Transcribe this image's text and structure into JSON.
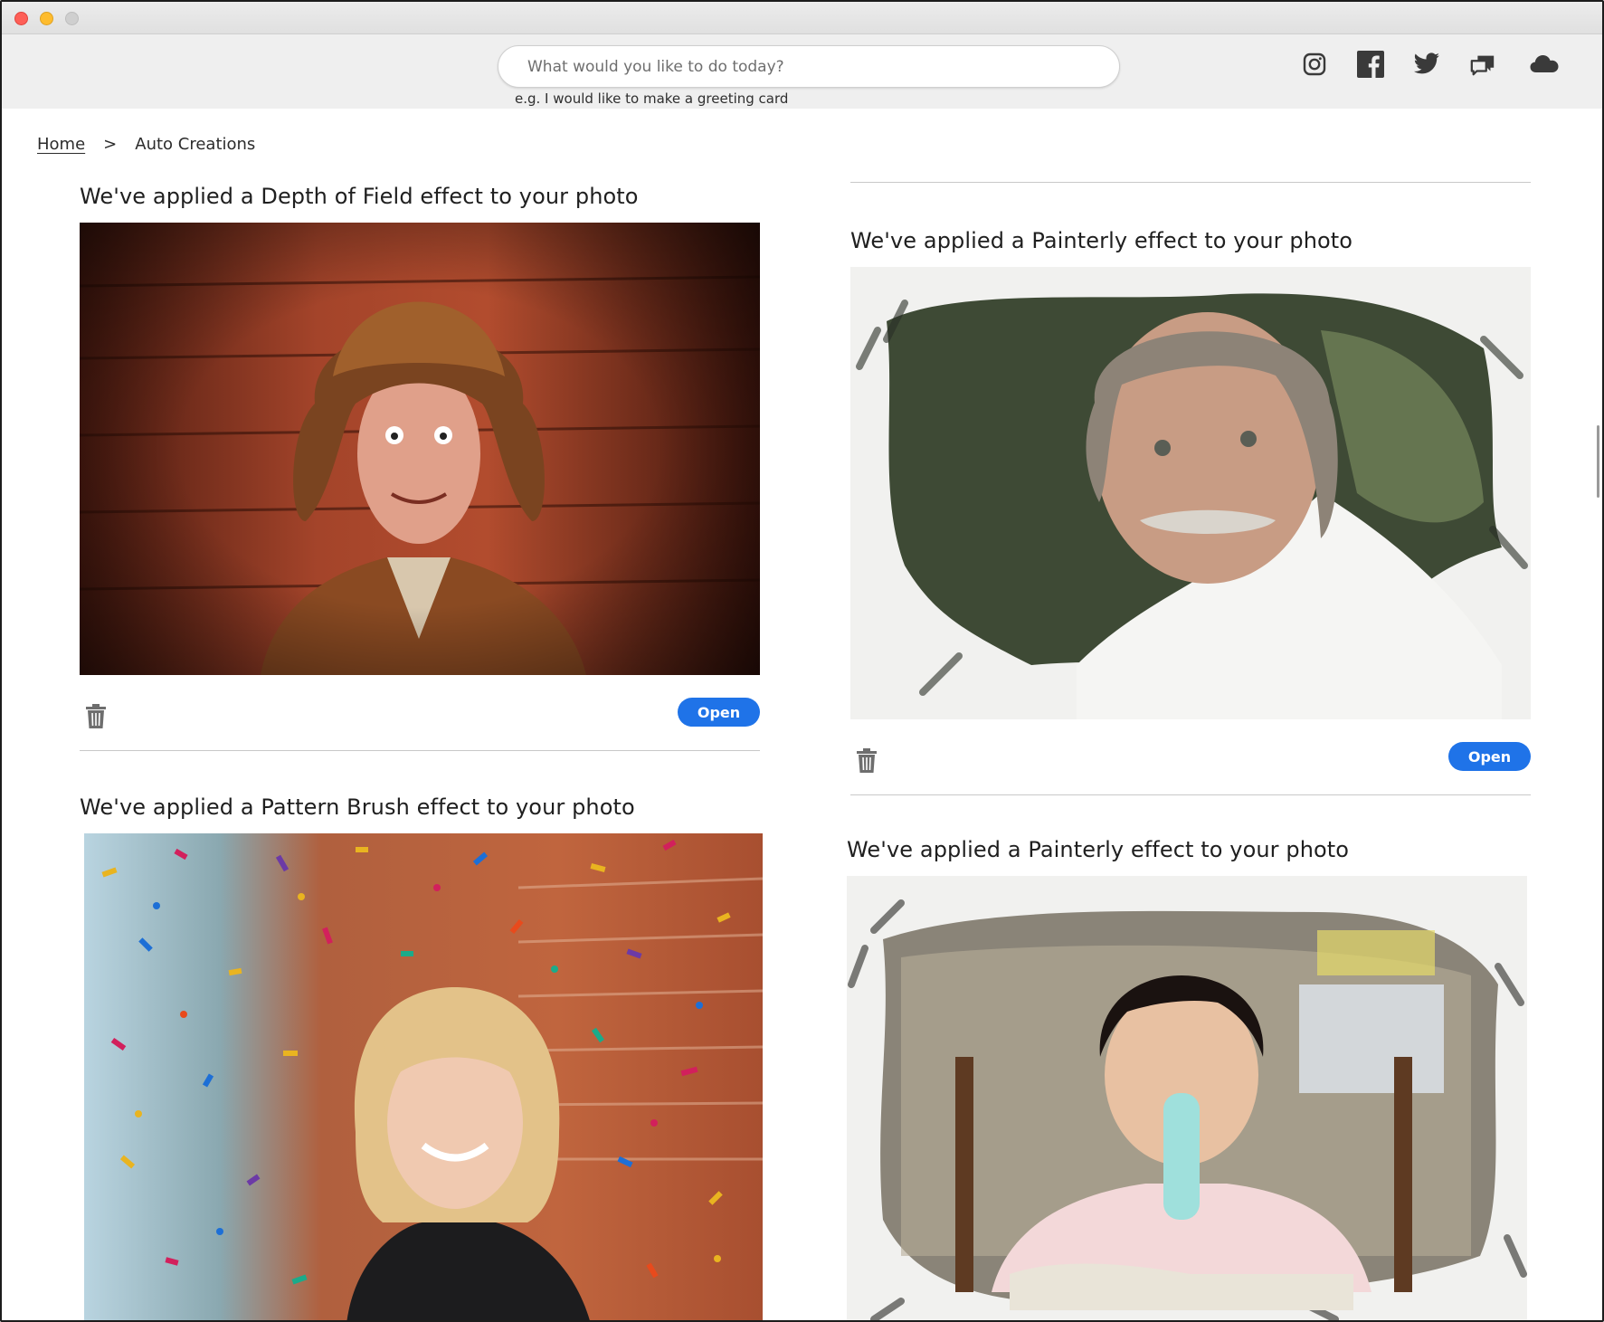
{
  "window": {
    "title": ""
  },
  "toolbar": {
    "search_placeholder": "What would you like to do today?",
    "search_hint": "e.g. I would like to make a greeting card",
    "icons": [
      "instagram-icon",
      "facebook-icon",
      "twitter-icon",
      "community-icon",
      "cloud-icon"
    ]
  },
  "breadcrumb": {
    "home": "Home",
    "separator": ">",
    "current": "Auto Creations"
  },
  "cards": [
    {
      "title": "We've applied a Depth of Field effect to your photo",
      "open_label": "Open"
    },
    {
      "title": "We've applied a Painterly effect to your photo",
      "open_label": "Open"
    },
    {
      "title": "We've applied a Pattern Brush effect to your photo"
    },
    {
      "title": "We've applied a Painterly effect to your photo"
    }
  ],
  "colors": {
    "accent": "#1f73e8",
    "toolbar_bg": "#efefef"
  }
}
